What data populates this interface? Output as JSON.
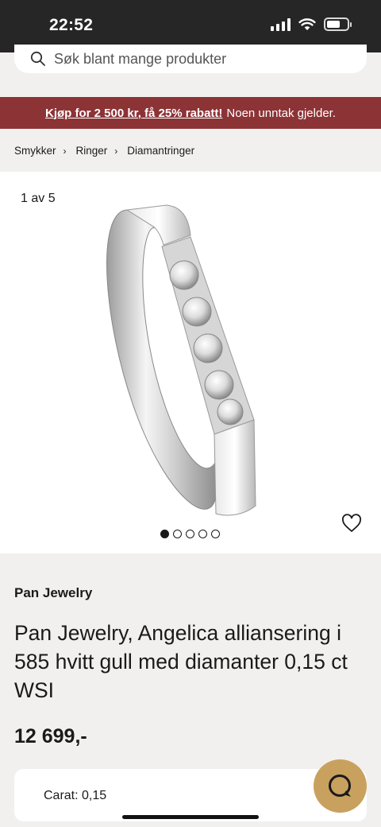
{
  "status_bar": {
    "time": "22:52",
    "battery_level": 0.65
  },
  "search": {
    "placeholder": "Søk blant mange produkter",
    "icon": "search-icon"
  },
  "promo": {
    "link_text": "Kjøp for 2 500 kr, få 25% rabatt!",
    "rest_text": "Noen unntak gjelder.",
    "background": "#8c3336"
  },
  "breadcrumb": {
    "items": [
      "Smykker",
      "Ringer",
      "Diamantringer"
    ],
    "separator": "›"
  },
  "gallery": {
    "counter": "1 av 5",
    "total_images": 5,
    "active_index": 0,
    "favorite_icon": "heart-outline-icon"
  },
  "product": {
    "brand": "Pan Jewelry",
    "title": "Pan Jewelry, Angelica alliansering i 585 hvitt gull med diamanter 0,15 ct WSI",
    "price": "12 699,-"
  },
  "specs": {
    "carat": "Carat: 0,15"
  },
  "chat": {
    "icon": "chat-bubble-icon",
    "color": "#c9a15e"
  }
}
